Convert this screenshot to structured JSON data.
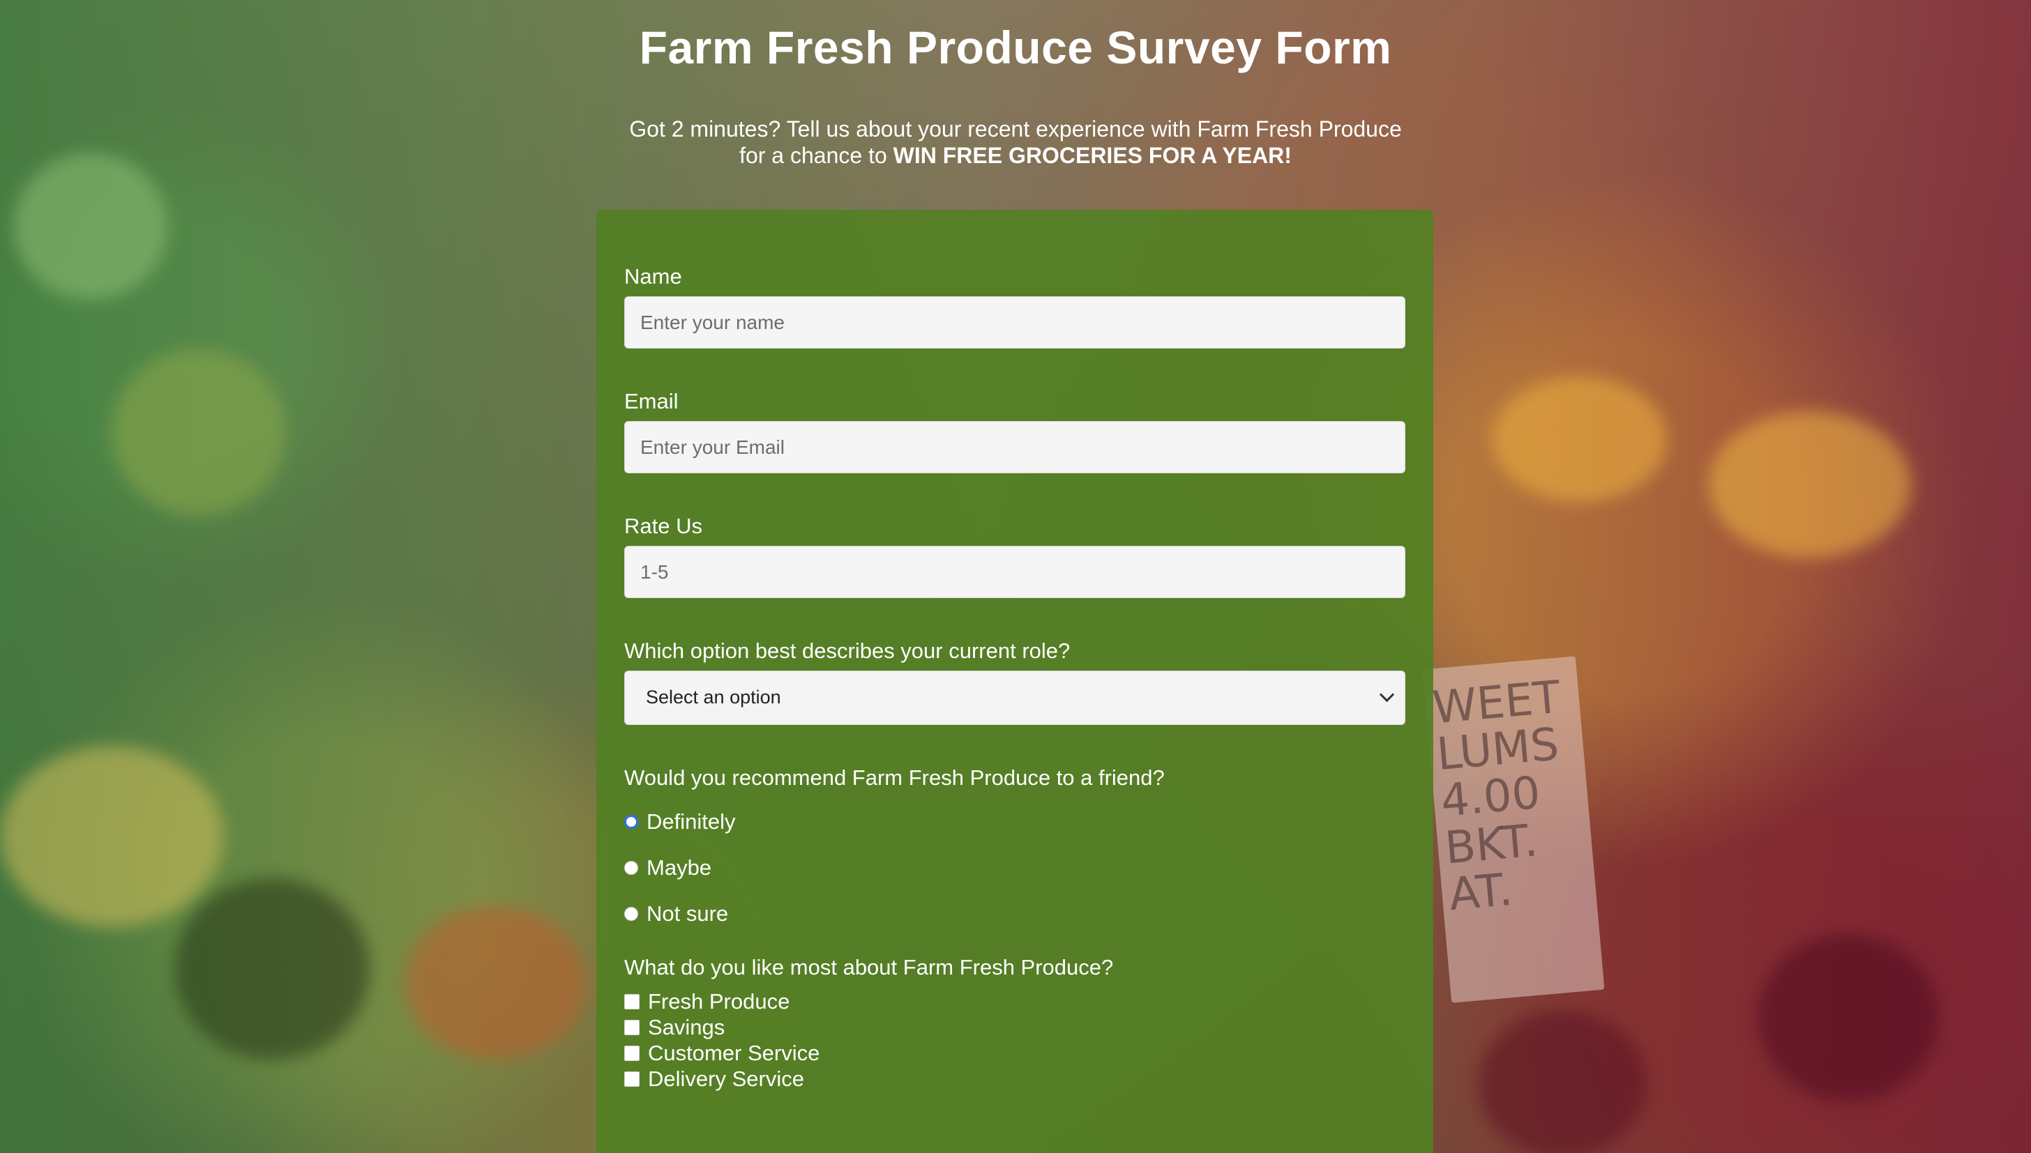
{
  "header": {
    "title": "Farm Fresh Produce Survey Form",
    "subtitle_prefix": "Got 2 minutes? Tell us about your recent experience with Farm Fresh Produce for a chance to ",
    "subtitle_emphasis": "WIN FREE GROCERIES FOR A YEAR!"
  },
  "form": {
    "name_label": "Name",
    "name_placeholder": "Enter your name",
    "email_label": "Email",
    "email_placeholder": "Enter your Email",
    "rating_label": "Rate Us",
    "rating_placeholder": "1-5",
    "role_label": "Which option best describes your current role?",
    "role_selected": "Select an option",
    "recommend_question": "Would you recommend Farm Fresh Produce to a friend?",
    "recommend_options": [
      "Definitely",
      "Maybe",
      "Not sure"
    ],
    "likes_question": "What do you like most about Farm Fresh Produce?",
    "likes_options": [
      "Fresh Produce",
      "Savings",
      "Customer Service",
      "Delivery Service"
    ]
  },
  "background": {
    "sign_text": "WEET LUMS 4.00 BKT. AT."
  },
  "colors": {
    "form_background": "#538024",
    "radio_accent": "#2d6ef7"
  }
}
